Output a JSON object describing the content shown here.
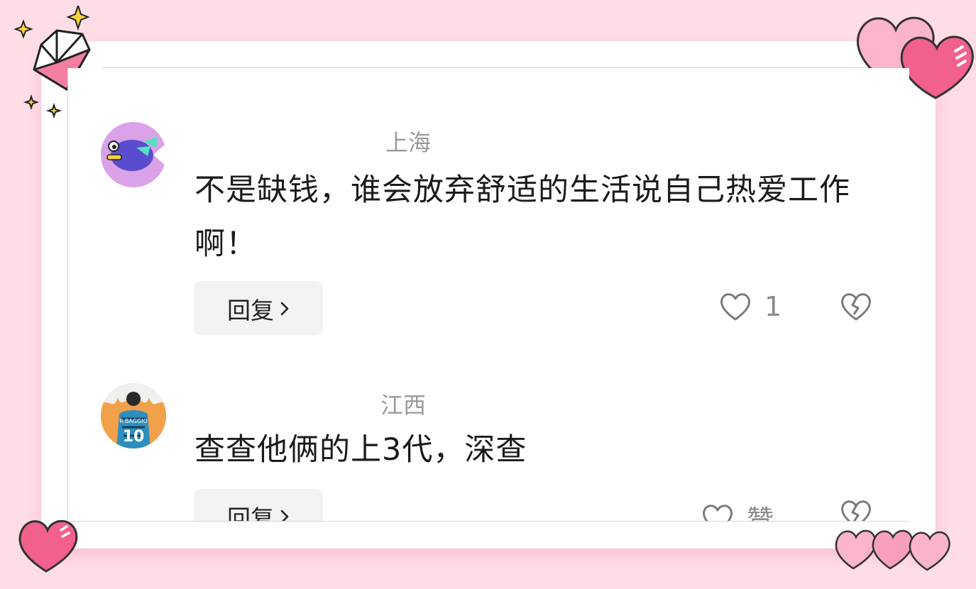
{
  "comments": [
    {
      "location": "上海",
      "text": "不是缺钱，谁会放弃舒适的生活说自己热爱工作啊！",
      "reply_label": "回复",
      "like_count": "1"
    },
    {
      "location": "江西",
      "text": "查查他俩的上3代，深查",
      "reply_label": "回复",
      "like_count": "赞"
    }
  ],
  "avatar2_caption": "R.BAGGIO 10",
  "colors": {
    "bg": "#ffdde7",
    "heart": "#f25c8a"
  }
}
